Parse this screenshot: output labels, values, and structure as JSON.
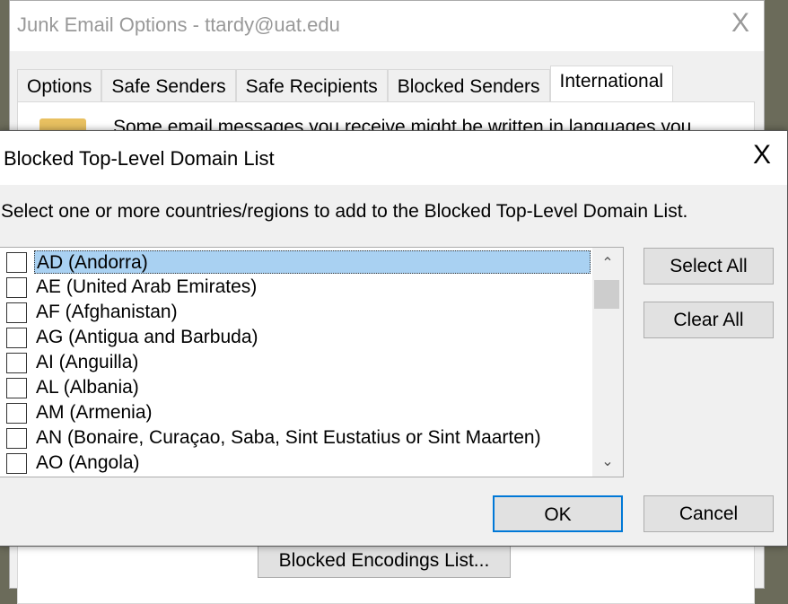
{
  "background_window": {
    "title": "Junk Email Options - ttardy@uat.edu",
    "close": "X",
    "tabs": [
      {
        "label": "Options"
      },
      {
        "label": "Safe Senders"
      },
      {
        "label": "Safe Recipients"
      },
      {
        "label": "Blocked Senders"
      },
      {
        "label": "International",
        "active": true
      }
    ],
    "panel_text": "Some email messages you receive might be written in languages you",
    "blocked_encodings_button": "Blocked Encodings List..."
  },
  "dialog": {
    "title": "Blocked Top-Level Domain List",
    "close": "X",
    "instruction": "Select one or more countries/regions to add to the Blocked Top-Level Domain List.",
    "items": [
      {
        "label": "AD (Andorra)",
        "checked": false,
        "selected": true
      },
      {
        "label": "AE (United Arab Emirates)",
        "checked": false
      },
      {
        "label": "AF (Afghanistan)",
        "checked": false
      },
      {
        "label": "AG (Antigua and Barbuda)",
        "checked": false
      },
      {
        "label": "AI (Anguilla)",
        "checked": false
      },
      {
        "label": "AL (Albania)",
        "checked": false
      },
      {
        "label": "AM (Armenia)",
        "checked": false
      },
      {
        "label": "AN (Bonaire, Curaçao, Saba, Sint Eustatius or Sint Maarten)",
        "checked": false
      },
      {
        "label": "AO (Angola)",
        "checked": false
      }
    ],
    "select_all": "Select All",
    "clear_all": "Clear All",
    "ok": "OK",
    "cancel": "Cancel",
    "accent": "#0078d7",
    "selection_color": "#a9d1f2"
  }
}
